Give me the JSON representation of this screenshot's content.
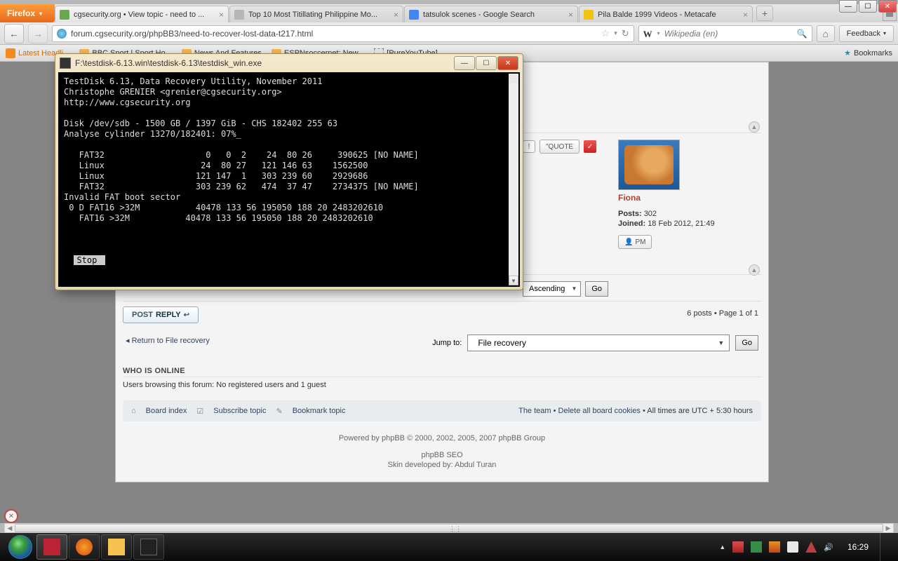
{
  "browser": {
    "firefox_label": "Firefox",
    "tabs": [
      {
        "title": "cgsecurity.org • View topic - need to ..."
      },
      {
        "title": "Top 10 Most Titillating Philippine Mo..."
      },
      {
        "title": "tatsulok scenes - Google Search"
      },
      {
        "title": "Pila Balde 1999 Videos - Metacafe"
      }
    ],
    "url": "forum.cgsecurity.org/phpBB3/need-to-recover-lost-data-t217.html",
    "search_placeholder": "Wikipedia (en)",
    "feedback_label": "Feedback",
    "bookmarks": {
      "latest": "Latest Headli...",
      "b1": "BBC Sport | Sport Ho...",
      "b2": "News And Features",
      "b3": "ESPNsoccernet: New...",
      "b4": "[PureYouTube]",
      "right": "Bookmarks"
    }
  },
  "console": {
    "title": "F:\\testdisk-6.13.win\\testdisk-6.13\\testdisk_win.exe",
    "lines": [
      "TestDisk 6.13, Data Recovery Utility, November 2011",
      "Christophe GRENIER <grenier@cgsecurity.org>",
      "http://www.cgsecurity.org",
      "",
      "Disk /dev/sdb - 1500 GB / 1397 GiB - CHS 182402 255 63",
      "Analyse cylinder 13270/182401: 07%_",
      "",
      "   FAT32                    0   0  2    24  80 26     390625 [NO NAME]",
      "   Linux                   24  80 27   121 146 63    1562500",
      "   Linux                  121 147  1   303 239 60    2929686",
      "   FAT32                  303 239 62   474  37 47    2734375 [NO NAME]",
      "Invalid FAT boot sector",
      " 0 D FAT16 >32M           40478 133 56 195050 188 20 2483202610",
      "   FAT16 >32M           40478 133 56 195050 188 20 2483202610"
    ],
    "stop_label": "Stop"
  },
  "forum": {
    "quote_label": "\"QUOTE",
    "user": {
      "name": "Fiona",
      "posts_label": "Posts:",
      "posts": "302",
      "joined_label": "Joined:",
      "joined": "18 Feb 2012, 21:49",
      "pm_label": "PM"
    },
    "sort": {
      "order": "Ascending",
      "go": "Go"
    },
    "postreply_a": "POST",
    "postreply_b": "REPLY",
    "pagecount": "6 posts • Page 1 of 1",
    "return": "Return to File recovery",
    "jump_label": "Jump to:",
    "jump_value": "File recovery",
    "jump_go": "Go",
    "who_head": "WHO IS ONLINE",
    "who_line": "Users browsing this forum: No registered users and 1 guest",
    "footer": {
      "board": "Board index",
      "subscribe": "Subscribe topic",
      "bookmark": "Bookmark topic",
      "team": "The team",
      "cookies": "Delete all board cookies",
      "times": "All times are UTC + 5:30 hours"
    },
    "powered": "Powered by phpBB © 2000, 2002, 2005, 2007 phpBB Group",
    "seo": "phpBB SEO",
    "skin": "Skin developed by: Abdul Turan"
  },
  "taskbar": {
    "clock": "16:29"
  }
}
